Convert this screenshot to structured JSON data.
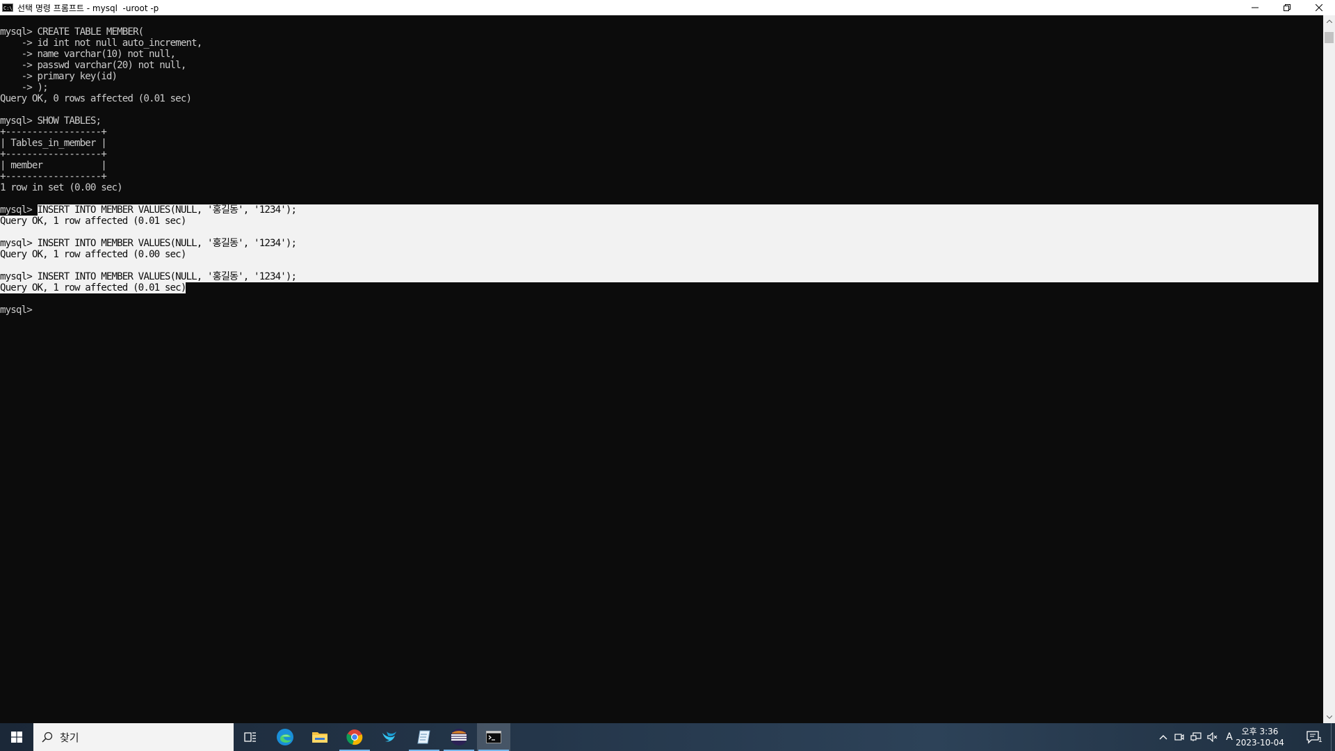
{
  "window": {
    "title": "선택 명령 프롬프트 - mysql  -uroot -p",
    "icon_label": "C:\\"
  },
  "terminal": {
    "lines": [
      "mysql> CREATE TABLE MEMBER(",
      "    -> id int not null auto_increment,",
      "    -> name varchar(10) not null,",
      "    -> passwd varchar(20) not null,",
      "    -> primary key(id)",
      "    -> );",
      "Query OK, 0 rows affected (0.01 sec)",
      "",
      "mysql> SHOW TABLES;",
      "+------------------+",
      "| Tables_in_member |",
      "+------------------+",
      "| member           |",
      "+------------------+",
      "1 row in set (0.00 sec)",
      "",
      "mysql> INSERT INTO MEMBER VALUES(NULL, '홍길동', '1234');",
      "Query OK, 1 row affected (0.01 sec)",
      "",
      "mysql> INSERT INTO MEMBER VALUES(NULL, '홍길동', '1234');",
      "Query OK, 1 row affected (0.00 sec)",
      "",
      "mysql> INSERT INTO MEMBER VALUES(NULL, '홍길동', '1234');",
      "Query OK, 1 row affected (0.01 sec)",
      "",
      "mysql>"
    ],
    "selection": {
      "first_line": 16,
      "last_line": 23,
      "first_line_start_char": 7
    }
  },
  "taskbar": {
    "search_placeholder": "찾기",
    "apps": [
      {
        "name": "task-view",
        "running": false,
        "active": false
      },
      {
        "name": "edge",
        "running": false,
        "active": false
      },
      {
        "name": "file-explorer",
        "running": false,
        "active": false
      },
      {
        "name": "chrome",
        "running": true,
        "active": false
      },
      {
        "name": "swift-app",
        "running": false,
        "active": false
      },
      {
        "name": "notepad-app",
        "running": true,
        "active": false
      },
      {
        "name": "eclipse",
        "running": true,
        "active": false
      },
      {
        "name": "command-prompt",
        "running": true,
        "active": true
      }
    ],
    "clock_time": "오후 3:36",
    "clock_date": "2023-10-04",
    "ime_indicator": "A",
    "notification_count": "1"
  },
  "colors": {
    "terminal_bg": "#0c0c0c",
    "terminal_fg": "#cccccc",
    "selection_bg": "#f2f2f2"
  }
}
